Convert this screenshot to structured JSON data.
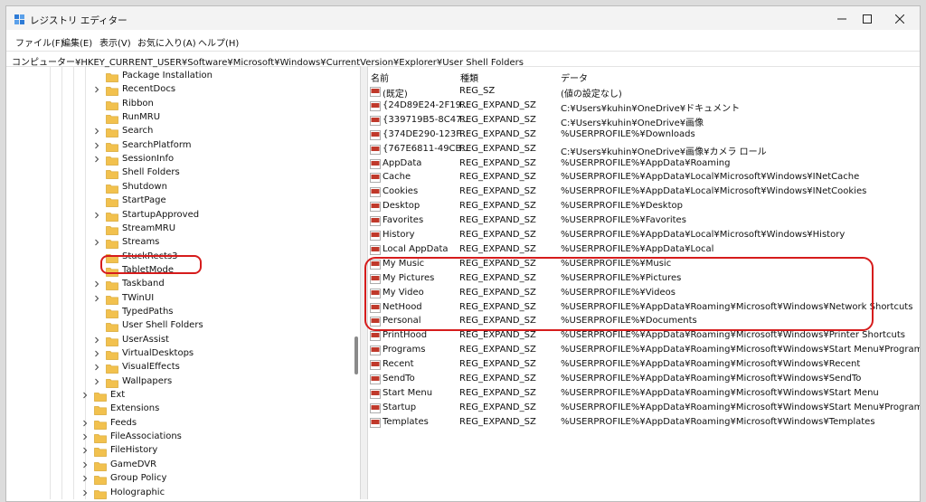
{
  "window": {
    "title": "レジストリ エディター",
    "controls": [
      "minimize",
      "maximize",
      "close"
    ]
  },
  "menu": [
    "ファイル(F)",
    "編集(E)",
    "表示(V)",
    "お気に入り(A)",
    "ヘルプ(H)"
  ],
  "address": "コンピューター¥HKEY_CURRENT_USER¥Software¥Microsoft¥Windows¥CurrentVersion¥Explorer¥User Shell Folders",
  "colors": {
    "folder": "#f2c14e",
    "highlight_ring": "#d61c1c",
    "reg_icon": "#c0392b"
  },
  "tree": [
    {
      "label": "Package Installation",
      "expandable": false,
      "level": 2
    },
    {
      "label": "RecentDocs",
      "expandable": true,
      "level": 2
    },
    {
      "label": "Ribbon",
      "expandable": false,
      "level": 2
    },
    {
      "label": "RunMRU",
      "expandable": false,
      "level": 2
    },
    {
      "label": "Search",
      "expandable": true,
      "level": 2
    },
    {
      "label": "SearchPlatform",
      "expandable": true,
      "level": 2
    },
    {
      "label": "SessionInfo",
      "expandable": true,
      "level": 2
    },
    {
      "label": "Shell Folders",
      "expandable": false,
      "level": 2
    },
    {
      "label": "Shutdown",
      "expandable": false,
      "level": 2
    },
    {
      "label": "StartPage",
      "expandable": false,
      "level": 2
    },
    {
      "label": "StartupApproved",
      "expandable": true,
      "level": 2
    },
    {
      "label": "StreamMRU",
      "expandable": false,
      "level": 2
    },
    {
      "label": "Streams",
      "expandable": true,
      "level": 2
    },
    {
      "label": "StuckRects3",
      "expandable": false,
      "level": 2
    },
    {
      "label": "TabletMode",
      "expandable": false,
      "level": 2
    },
    {
      "label": "Taskband",
      "expandable": true,
      "level": 2
    },
    {
      "label": "TWinUI",
      "expandable": true,
      "level": 2
    },
    {
      "label": "TypedPaths",
      "expandable": false,
      "level": 2
    },
    {
      "label": "User Shell Folders",
      "expandable": false,
      "level": 2,
      "selected": true
    },
    {
      "label": "UserAssist",
      "expandable": true,
      "level": 2
    },
    {
      "label": "VirtualDesktops",
      "expandable": true,
      "level": 2
    },
    {
      "label": "VisualEffects",
      "expandable": true,
      "level": 2
    },
    {
      "label": "Wallpapers",
      "expandable": true,
      "level": 2
    },
    {
      "label": "Ext",
      "expandable": true,
      "level": 1
    },
    {
      "label": "Extensions",
      "expandable": false,
      "level": 1
    },
    {
      "label": "Feeds",
      "expandable": true,
      "level": 1
    },
    {
      "label": "FileAssociations",
      "expandable": true,
      "level": 1
    },
    {
      "label": "FileHistory",
      "expandable": true,
      "level": 1
    },
    {
      "label": "GameDVR",
      "expandable": true,
      "level": 1
    },
    {
      "label": "Group Policy",
      "expandable": true,
      "level": 1
    },
    {
      "label": "Holographic",
      "expandable": true,
      "level": 1
    }
  ],
  "columns": [
    "名前",
    "種類",
    "データ"
  ],
  "values": [
    {
      "name": "(既定)",
      "type": "REG_SZ",
      "data": "(値の設定なし)"
    },
    {
      "name": "{24D89E24-2F19...",
      "type": "REG_EXPAND_SZ",
      "data": "C:¥Users¥kuhin¥OneDrive¥ドキュメント"
    },
    {
      "name": "{339719B5-8C47...",
      "type": "REG_EXPAND_SZ",
      "data": "C:¥Users¥kuhin¥OneDrive¥画像"
    },
    {
      "name": "{374DE290-123F...",
      "type": "REG_EXPAND_SZ",
      "data": "%USERPROFILE%¥Downloads"
    },
    {
      "name": "{767E6811-49CB...",
      "type": "REG_EXPAND_SZ",
      "data": "C:¥Users¥kuhin¥OneDrive¥画像¥カメラ ロール"
    },
    {
      "name": "AppData",
      "type": "REG_EXPAND_SZ",
      "data": "%USERPROFILE%¥AppData¥Roaming"
    },
    {
      "name": "Cache",
      "type": "REG_EXPAND_SZ",
      "data": "%USERPROFILE%¥AppData¥Local¥Microsoft¥Windows¥INetCache"
    },
    {
      "name": "Cookies",
      "type": "REG_EXPAND_SZ",
      "data": "%USERPROFILE%¥AppData¥Local¥Microsoft¥Windows¥INetCookies"
    },
    {
      "name": "Desktop",
      "type": "REG_EXPAND_SZ",
      "data": "%USERPROFILE%¥Desktop"
    },
    {
      "name": "Favorites",
      "type": "REG_EXPAND_SZ",
      "data": "%USERPROFILE%¥Favorites"
    },
    {
      "name": "History",
      "type": "REG_EXPAND_SZ",
      "data": "%USERPROFILE%¥AppData¥Local¥Microsoft¥Windows¥History"
    },
    {
      "name": "Local AppData",
      "type": "REG_EXPAND_SZ",
      "data": "%USERPROFILE%¥AppData¥Local"
    },
    {
      "name": "My Music",
      "type": "REG_EXPAND_SZ",
      "data": "%USERPROFILE%¥Music"
    },
    {
      "name": "My Pictures",
      "type": "REG_EXPAND_SZ",
      "data": "%USERPROFILE%¥Pictures"
    },
    {
      "name": "My Video",
      "type": "REG_EXPAND_SZ",
      "data": "%USERPROFILE%¥Videos"
    },
    {
      "name": "NetHood",
      "type": "REG_EXPAND_SZ",
      "data": "%USERPROFILE%¥AppData¥Roaming¥Microsoft¥Windows¥Network Shortcuts"
    },
    {
      "name": "Personal",
      "type": "REG_EXPAND_SZ",
      "data": "%USERPROFILE%¥Documents"
    },
    {
      "name": "PrintHood",
      "type": "REG_EXPAND_SZ",
      "data": "%USERPROFILE%¥AppData¥Roaming¥Microsoft¥Windows¥Printer Shortcuts"
    },
    {
      "name": "Programs",
      "type": "REG_EXPAND_SZ",
      "data": "%USERPROFILE%¥AppData¥Roaming¥Microsoft¥Windows¥Start Menu¥Programs"
    },
    {
      "name": "Recent",
      "type": "REG_EXPAND_SZ",
      "data": "%USERPROFILE%¥AppData¥Roaming¥Microsoft¥Windows¥Recent"
    },
    {
      "name": "SendTo",
      "type": "REG_EXPAND_SZ",
      "data": "%USERPROFILE%¥AppData¥Roaming¥Microsoft¥Windows¥SendTo"
    },
    {
      "name": "Start Menu",
      "type": "REG_EXPAND_SZ",
      "data": "%USERPROFILE%¥AppData¥Roaming¥Microsoft¥Windows¥Start Menu"
    },
    {
      "name": "Startup",
      "type": "REG_EXPAND_SZ",
      "data": "%USERPROFILE%¥AppData¥Roaming¥Microsoft¥Windows¥Start Menu¥Programs¥Start..."
    },
    {
      "name": "Templates",
      "type": "REG_EXPAND_SZ",
      "data": "%USERPROFILE%¥AppData¥Roaming¥Microsoft¥Windows¥Templates"
    }
  ]
}
